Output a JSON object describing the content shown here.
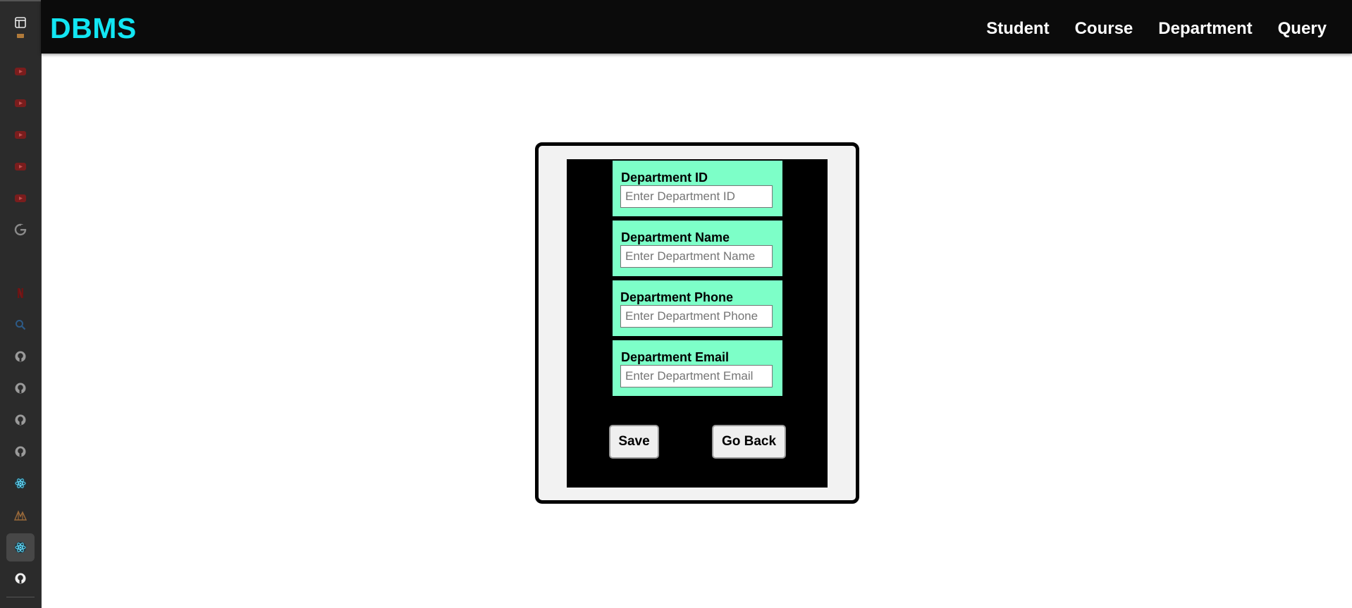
{
  "navbar": {
    "brand": "DBMS",
    "links": [
      {
        "label": "Student"
      },
      {
        "label": "Course"
      },
      {
        "label": "Department"
      },
      {
        "label": "Query"
      }
    ]
  },
  "form": {
    "fields": [
      {
        "label": "Department ID",
        "placeholder": "Enter Department ID",
        "value": ""
      },
      {
        "label": "Department Name",
        "placeholder": "Enter Department Name",
        "value": ""
      },
      {
        "label": "Department Phone",
        "placeholder": "Enter Department Phone",
        "value": ""
      },
      {
        "label": "Department Email",
        "placeholder": "Enter Department Email",
        "value": ""
      }
    ],
    "save_label": "Save",
    "back_label": "Go Back"
  },
  "colors": {
    "brand": "#12e6f3",
    "navbar_bg": "#0b0b0b",
    "field_bg": "#7dffc8",
    "form_bg": "#000000",
    "card_bg": "#f2f2f2"
  },
  "sidebar": {
    "icons": [
      "panel-icon",
      "tab-favicon-icon",
      "youtube-icon",
      "youtube-icon",
      "youtube-icon",
      "youtube-icon",
      "youtube-icon",
      "google-icon",
      "netflix-icon",
      "search-icon",
      "github-icon",
      "github-icon",
      "github-icon",
      "github-icon",
      "react-icon",
      "mountain-icon",
      "react-icon",
      "github-icon"
    ]
  }
}
